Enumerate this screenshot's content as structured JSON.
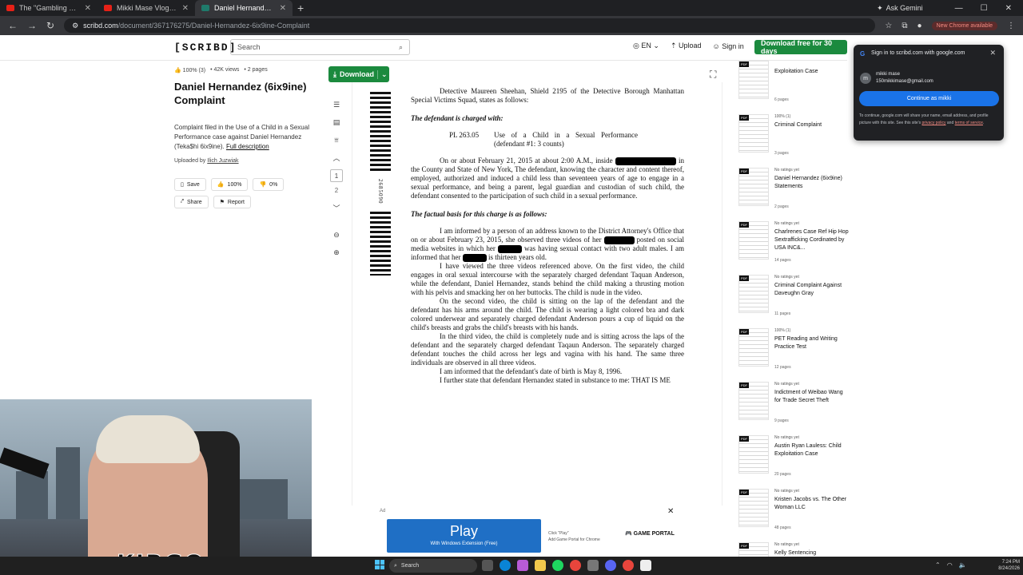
{
  "browser": {
    "tabs": [
      {
        "title": "The \"Gambling Genius\" Who F..."
      },
      {
        "title": "Mikki Mase Vlogs - YouTube"
      },
      {
        "title": "Daniel Hernandez (6ix9ine) Co..."
      }
    ],
    "gemini": "Ask Gemini",
    "url_site": "scribd.com",
    "url_path": "/document/367176275/Daniel-Hernandez-6ix9ine-Complaint",
    "update_label": "New Chrome available"
  },
  "header": {
    "logo": "[SCRIBD]",
    "search_placeholder": "Search",
    "lang": "EN",
    "upload": "Upload",
    "signin": "Sign in",
    "download_free": "Download free for 30 days"
  },
  "doc": {
    "rating": "100% (3)",
    "views": "42K views",
    "pages": "2 pages",
    "title": "Daniel Hernandez (6ix9ine) Complaint",
    "description": "Complaint filed in the Use of a Child in a Sexual Performance case against Daniel Hernandez (Teka$hi 6ix9ine).",
    "full_desc": "Full description",
    "uploaded_by_label": "Uploaded by",
    "uploader": "Ilich Juzwiak",
    "actions": {
      "save": "Save",
      "like": "100%",
      "dislike": "0%",
      "share": "Share",
      "report": "Report"
    }
  },
  "webcam": {
    "name": "KIRGO"
  },
  "viewer": {
    "download": "Download",
    "page_current": "1",
    "page_next": "2",
    "barcode_number": "2685090",
    "text": {
      "intro": "Detective Maureen Sheehan, Shield 2195 of the Detective Borough Manhattan Special Victims Squad, states as follows:",
      "charged_heading": "The defendant is charged with:",
      "charge_code": "PL 263.05",
      "charge_desc": "Use of a Child in a Sexual Performance (defendant #1: 3 counts)",
      "para1a": "On or about February 21, 2015 at about 2:00 A.M., inside",
      "para1b": "in the County and State of New York, The defendant, knowing the character and content thereof, employed, authorized and induced a child less than seventeen years of age to engage in a sexual performance, and being a parent, legal guardian and custodian of such child, the defendant consented to the participation of such child in a sexual performance.",
      "factual_heading": "The factual basis for this charge is as follows:",
      "para2a": "I am informed by a person of an address known to the District Attorney's Office that on or about February 23, 2015, she observed three videos of her",
      "para2b": "posted on social media websites in which her",
      "para2c": "was having sexual contact with two adult males. I am informed that her",
      "para2d": "is thirteen years old.",
      "para3": "I have viewed the three videos referenced above. On the first video, the child engages in oral sexual intercourse with the separately charged defendant Taquan Anderson, while the defendant, Daniel Hernandez, stands behind the child making a thrusting motion with his pelvis and smacking her on her buttocks. The child is nude in the video.",
      "para4": "On the second video, the child is sitting on the lap of the defendant and the defendant has his arms around the child. The child is wearing a light colored bra and dark colored underwear and separately charged defendant Anderson pours a cup of liquid on the child's breasts and grabs the child's breasts with his hands.",
      "para5": "In the third video, the child is completely nude and is sitting across the laps of the defendant and the separately charged defendant Taqaun Anderson. The separately charged defendant touches the child across her legs and vagina with his hand. The same three individuals are observed in all three videos.",
      "para6": "I am informed that the defendant's date of birth is May 8, 1996.",
      "para7": "I further state that defendant Hernandez stated in substance to me: THAT IS ME"
    }
  },
  "ad": {
    "label": "Ad",
    "play": "Play",
    "play_sub": "With Windows Extension (Free)",
    "step1": "Click \"Play\"",
    "step2": "Add Game Portal for Chrome",
    "portal": "GAME PORTAL"
  },
  "related": [
    {
      "meta": "",
      "title": "Exploitation Case",
      "pages": "6 pages"
    },
    {
      "meta": "100% (1)",
      "title": "Criminal Complaint",
      "pages": "3 pages"
    },
    {
      "meta": "No ratings yet",
      "title": "Daniel Hernandez (6ix9ine) Statements",
      "pages": "2 pages"
    },
    {
      "meta": "No ratings yet",
      "title": "Charlrenes Case Ref Hip Hop Sextrafficking Cordinated by USA INC&...",
      "pages": "14 pages"
    },
    {
      "meta": "No ratings yet",
      "title": "Criminal Complaint Against Daveughn Gray",
      "pages": "11 pages"
    },
    {
      "meta": "100% (1)",
      "title": "PET Reading and Writing Practice Test",
      "pages": "12 pages"
    },
    {
      "meta": "No ratings yet",
      "title": "Indictment of Weibao Wang for Trade Secret Theft",
      "pages": "9 pages"
    },
    {
      "meta": "No ratings yet",
      "title": "Austin Ryan Lauless: Child Exploitation Case",
      "pages": "20 pages"
    },
    {
      "meta": "No ratings yet",
      "title": "Kristen Jacobs vs. The Other Woman LLC",
      "pages": "48 pages"
    },
    {
      "meta": "No ratings yet",
      "title": "Kelly Sentencing Memorandum Analysis",
      "pages": ""
    }
  ],
  "google_popup": {
    "header": "Sign in to scribd.com with google.com",
    "avatar": "m",
    "name": "mikki mase",
    "email": "150mikkimase@gmail.com",
    "continue": "Continue as mikki",
    "fine_a": "To continue, google.com will share your name, email address, and profile picture with this site. See this site's",
    "privacy": "privacy policy",
    "fine_b": "and",
    "terms": "terms of service",
    "fine_c": "."
  },
  "taskbar": {
    "search": "Search",
    "time": "7:24 PM",
    "date": "8/24/2026"
  }
}
